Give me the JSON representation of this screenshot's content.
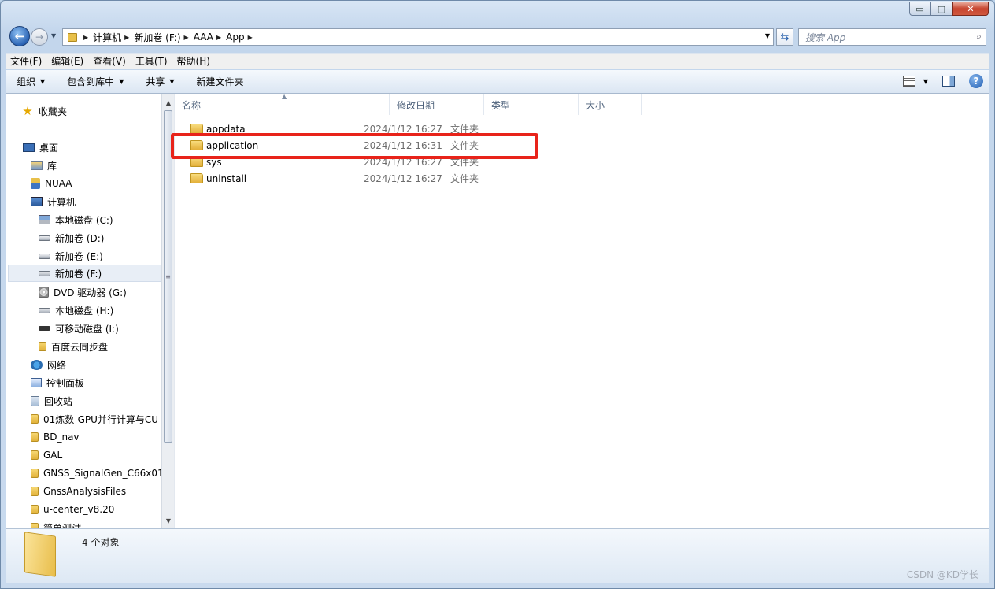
{
  "window": {
    "caption_buttons": {
      "minimize": "▭",
      "maximize": "□",
      "close": "✕"
    }
  },
  "nav": {
    "breadcrumbs": [
      "计算机",
      "新加卷 (F:)",
      "AAA",
      "App"
    ],
    "search_placeholder": "搜索 App"
  },
  "menu": [
    "文件(F)",
    "编辑(E)",
    "查看(V)",
    "工具(T)",
    "帮助(H)"
  ],
  "toolbar": {
    "organize": "组织",
    "include_library": "包含到库中",
    "share": "共享",
    "new_folder": "新建文件夹"
  },
  "sidebar": {
    "items": [
      {
        "label": "收藏夹",
        "icon": "star-icon"
      },
      {
        "label": "桌面",
        "icon": "desktop-icon"
      },
      {
        "label": "库",
        "icon": "library-icon"
      },
      {
        "label": "NUAA",
        "icon": "user-icon"
      },
      {
        "label": "计算机",
        "icon": "computer-icon"
      },
      {
        "label": "本地磁盘 (C:)",
        "icon": "system-drive-icon"
      },
      {
        "label": "新加卷 (D:)",
        "icon": "drive-icon"
      },
      {
        "label": "新加卷 (E:)",
        "icon": "drive-icon"
      },
      {
        "label": "新加卷 (F:)",
        "icon": "drive-icon",
        "selected": true
      },
      {
        "label": "DVD 驱动器 (G:)",
        "icon": "dvd-icon"
      },
      {
        "label": "本地磁盘 (H:)",
        "icon": "drive-icon"
      },
      {
        "label": "可移动磁盘 (I:)",
        "icon": "usb-drive-icon"
      },
      {
        "label": "百度云同步盘",
        "icon": "folder-icon"
      },
      {
        "label": "网络",
        "icon": "network-icon"
      },
      {
        "label": "控制面板",
        "icon": "control-panel-icon"
      },
      {
        "label": "回收站",
        "icon": "recycle-bin-icon"
      },
      {
        "label": "01炼数-GPU并行计算与CU",
        "icon": "folder-icon"
      },
      {
        "label": "BD_nav",
        "icon": "folder-icon"
      },
      {
        "label": "GAL",
        "icon": "folder-icon"
      },
      {
        "label": "GNSS_SignalGen_C66x01",
        "icon": "folder-icon"
      },
      {
        "label": "GnssAnalysisFiles",
        "icon": "folder-icon"
      },
      {
        "label": "u-center_v8.20",
        "icon": "folder-icon"
      },
      {
        "label": "简单测试",
        "icon": "folder-icon"
      }
    ]
  },
  "columns": [
    "名称",
    "修改日期",
    "类型",
    "大小"
  ],
  "files": [
    {
      "name": "appdata",
      "date": "2024/1/12 16:27",
      "type": "文件夹"
    },
    {
      "name": "application",
      "date": "2024/1/12 16:31",
      "type": "文件夹",
      "highlighted": true
    },
    {
      "name": "sys",
      "date": "2024/1/12 16:27",
      "type": "文件夹"
    },
    {
      "name": "uninstall",
      "date": "2024/1/12 16:27",
      "type": "文件夹"
    }
  ],
  "status": {
    "count": "4 个对象"
  },
  "watermark": "CSDN @KD学长",
  "colors": {
    "highlight": "#e8231a",
    "selection": "#e8eef6"
  }
}
